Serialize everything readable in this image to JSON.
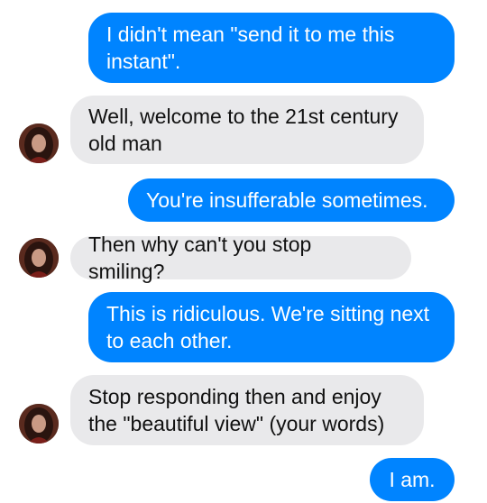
{
  "conversation": {
    "messages": [
      {
        "from": "me",
        "text": "I didn't mean \"send it to me this instant\"."
      },
      {
        "from": "them",
        "text": "Well, welcome to the 21st century old man"
      },
      {
        "from": "me",
        "text": "You're insufferable sometimes."
      },
      {
        "from": "them",
        "text": "Then why can't you stop smiling?"
      },
      {
        "from": "me",
        "text": "This is ridiculous. We're sitting next to each other."
      },
      {
        "from": "them",
        "text": "Stop responding then and enjoy the \"beautiful view\" (your words)"
      },
      {
        "from": "me",
        "text": "I am."
      }
    ]
  },
  "colors": {
    "outgoing_bubble": "#0084ff",
    "incoming_bubble": "#e9e9eb",
    "outgoing_text": "#ffffff",
    "incoming_text": "#111111"
  },
  "icons": {
    "contact_avatar": "contact-avatar-photo"
  }
}
